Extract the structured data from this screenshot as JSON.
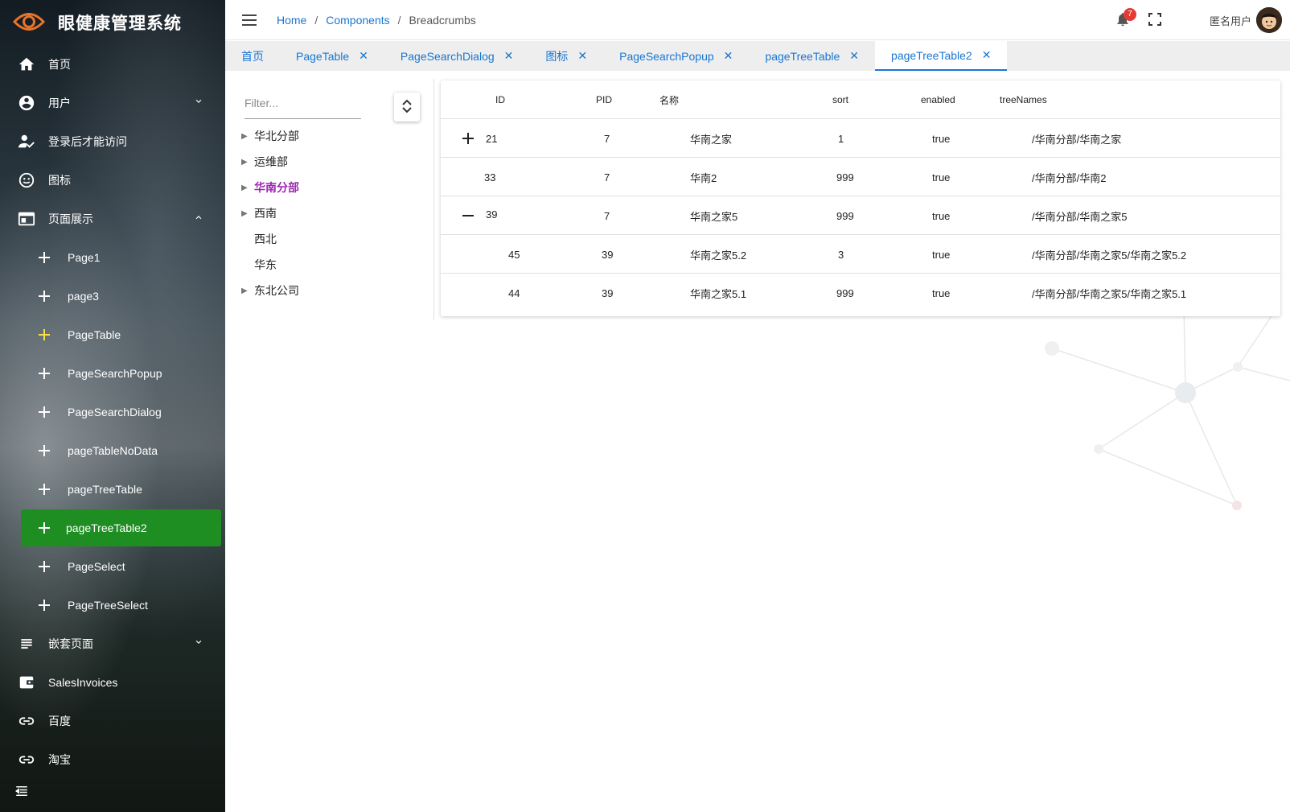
{
  "app": {
    "title": "眼健康管理系统"
  },
  "sidebar": {
    "items": [
      {
        "label": "首页"
      },
      {
        "label": "用户"
      },
      {
        "label": "登录后才能访问"
      },
      {
        "label": "图标"
      },
      {
        "label": "页面展示"
      },
      {
        "label": "Page1"
      },
      {
        "label": "page3"
      },
      {
        "label": "PageTable"
      },
      {
        "label": "PageSearchPopup"
      },
      {
        "label": "PageSearchDialog"
      },
      {
        "label": "pageTableNoData"
      },
      {
        "label": "pageTreeTable"
      },
      {
        "label": "pageTreeTable2"
      },
      {
        "label": "PageSelect"
      },
      {
        "label": "PageTreeSelect"
      },
      {
        "label": "嵌套页面"
      },
      {
        "label": "SalesInvoices"
      },
      {
        "label": "百度"
      },
      {
        "label": "淘宝"
      }
    ]
  },
  "header": {
    "breadcrumbs": [
      "Home",
      "Components",
      "Breadcrumbs"
    ],
    "separator": "/",
    "notification_count": "7",
    "user_name": "匿名用户"
  },
  "tabs": [
    {
      "label": "首页"
    },
    {
      "label": "PageTable"
    },
    {
      "label": "PageSearchDialog"
    },
    {
      "label": "图标"
    },
    {
      "label": "PageSearchPopup"
    },
    {
      "label": "pageTreeTable"
    },
    {
      "label": "pageTreeTable2"
    }
  ],
  "tab_close_glyph": "✕",
  "tree": {
    "filter_placeholder": "Filter...",
    "nodes": [
      {
        "label": "华北分部"
      },
      {
        "label": "运维部"
      },
      {
        "label": "华南分部"
      },
      {
        "label": "西南"
      },
      {
        "label": "西北"
      },
      {
        "label": "华东"
      },
      {
        "label": "东北公司"
      }
    ]
  },
  "table": {
    "headers": [
      "ID",
      "PID",
      "名称",
      "sort",
      "enabled",
      "treeNames"
    ],
    "rows": [
      {
        "id": "21",
        "pid": "7",
        "name": "华南之家",
        "sort": "1",
        "enabled": "true",
        "treeNames": "/华南分部/华南之家"
      },
      {
        "id": "33",
        "pid": "7",
        "name": "华南2",
        "sort": "999",
        "enabled": "true",
        "treeNames": "/华南分部/华南2"
      },
      {
        "id": "39",
        "pid": "7",
        "name": "华南之家5",
        "sort": "999",
        "enabled": "true",
        "treeNames": "/华南分部/华南之家5"
      },
      {
        "id": "45",
        "pid": "39",
        "name": "华南之家5.2",
        "sort": "3",
        "enabled": "true",
        "treeNames": "/华南分部/华南之家5/华南之家5.2"
      },
      {
        "id": "44",
        "pid": "39",
        "name": "华南之家5.1",
        "sort": "999",
        "enabled": "true",
        "treeNames": "/华南分部/华南之家5/华南之家5.1"
      }
    ]
  },
  "colors": {
    "accent": "#1976d2",
    "active_menu": "#1e8e22",
    "selected_tree": "#9c27b0",
    "badge": "#e53935",
    "logo": "#e8742a"
  }
}
